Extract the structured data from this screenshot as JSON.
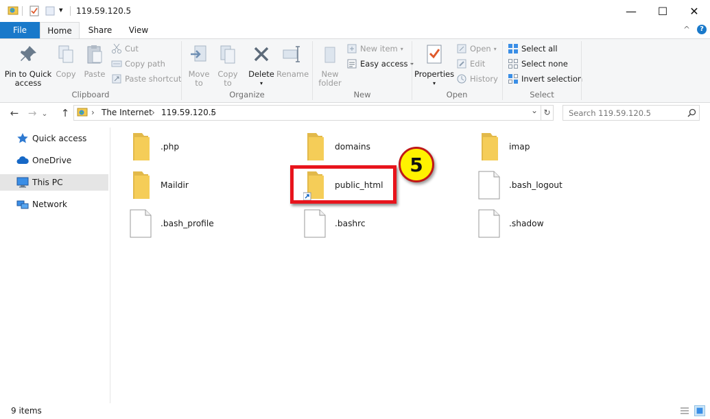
{
  "window": {
    "title": "119.59.120.5",
    "minimize": "—",
    "maximize": "☐",
    "close": "✕",
    "qa_dropdown": "▾"
  },
  "tabs": {
    "file": "File",
    "home": "Home",
    "share": "Share",
    "view": "View"
  },
  "ribbon": {
    "clipboard": {
      "label": "Clipboard",
      "pin": "Pin to Quick\naccess",
      "pin_l1": "Pin to Quick",
      "pin_l2": "access",
      "copy": "Copy",
      "paste": "Paste",
      "cut": "Cut",
      "copy_path": "Copy path",
      "paste_shortcut": "Paste shortcut"
    },
    "organize": {
      "label": "Organize",
      "move_to_l1": "Move",
      "move_to_l2": "to",
      "copy_to_l1": "Copy",
      "copy_to_l2": "to",
      "delete": "Delete",
      "rename": "Rename"
    },
    "new": {
      "label": "New",
      "new_folder_l1": "New",
      "new_folder_l2": "folder",
      "new_item": "New item",
      "easy_access": "Easy access"
    },
    "open": {
      "label": "Open",
      "properties": "Properties",
      "open": "Open",
      "edit": "Edit",
      "history": "History"
    },
    "select": {
      "label": "Select",
      "select_all": "Select all",
      "select_none": "Select none",
      "invert": "Invert selection"
    }
  },
  "address": {
    "crumb1": "The Internet",
    "crumb2": "119.59.120.5",
    "chev": "›",
    "dropdown": "⌄",
    "refresh": "↻"
  },
  "search": {
    "placeholder": "Search 119.59.120.5",
    "icon": "search-icon"
  },
  "nav": {
    "back": "←",
    "forward": "→",
    "recent": "⌄",
    "up": "↑",
    "items": [
      {
        "label": "Quick access",
        "icon": "star-icon"
      },
      {
        "label": "OneDrive",
        "icon": "cloud-icon"
      },
      {
        "label": "This PC",
        "icon": "computer-icon",
        "selected": true
      },
      {
        "label": "Network",
        "icon": "network-icon"
      }
    ]
  },
  "files": [
    {
      "name": ".php",
      "type": "folder"
    },
    {
      "name": "domains",
      "type": "folder"
    },
    {
      "name": "imap",
      "type": "folder"
    },
    {
      "name": "Maildir",
      "type": "folder"
    },
    {
      "name": "public_html",
      "type": "folder-shortcut"
    },
    {
      "name": ".bash_logout",
      "type": "file"
    },
    {
      "name": ".bash_profile",
      "type": "file"
    },
    {
      "name": ".bashrc",
      "type": "file"
    },
    {
      "name": ".shadow",
      "type": "file"
    }
  ],
  "annotation": {
    "step": "5",
    "highlight_color": "#e8141c",
    "badge_color": "#fff200"
  },
  "status": {
    "count": "9 items"
  },
  "colors": {
    "file_tab": "#1979ca",
    "folder": "#f5cd58",
    "selected_nav": "#e5e5e5"
  }
}
